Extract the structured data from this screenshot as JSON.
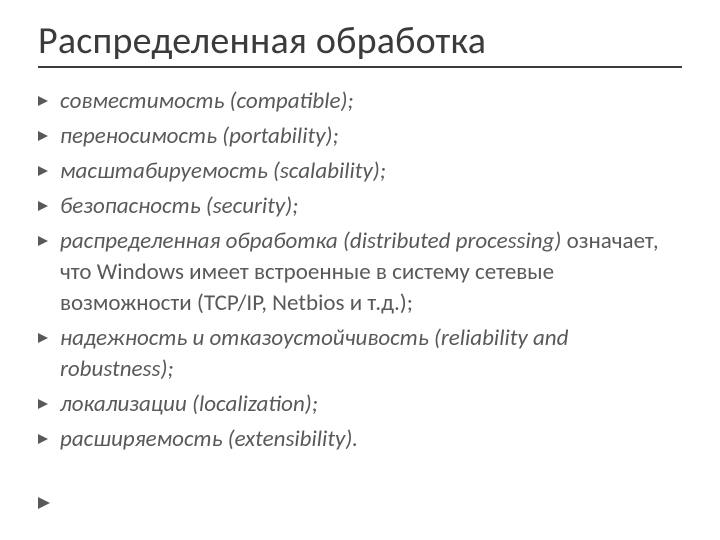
{
  "title": "Распределенная обработка",
  "items": [
    {
      "ital": "совместимость (compatible);",
      "plain": ""
    },
    {
      "ital": "переносимость (portability);",
      "plain": ""
    },
    {
      "ital": "масштабируемость (scalability);",
      "plain": ""
    },
    {
      "ital": "безопасность (security);",
      "plain": ""
    },
    {
      "ital": "распределенная обработка (distributed processing)",
      "plain": " означает, что Windows имеет встроенные в систему сетевые возможности (TCP/IP, Netbios и т.д.);"
    },
    {
      "ital": "надежность и отказоустойчивость (reliability and robustness);",
      "plain": ""
    },
    {
      "ital": "локализации (localization);",
      "plain": ""
    },
    {
      "ital": "расширяемость (extensibility).",
      "plain": ""
    }
  ]
}
